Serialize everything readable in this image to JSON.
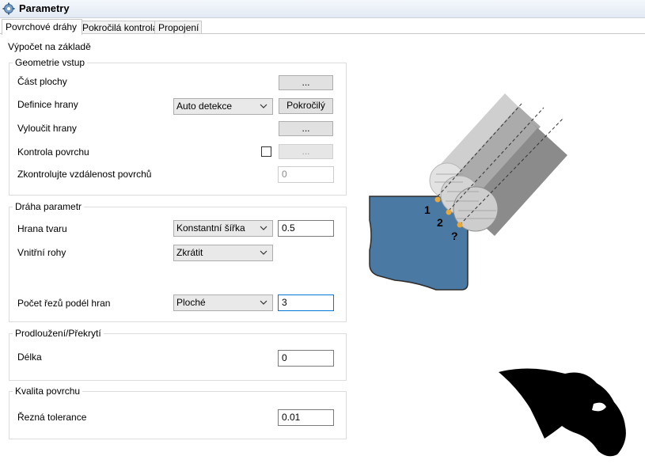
{
  "window": {
    "title": "Parametry"
  },
  "tabs": [
    {
      "label": "Povrchové dráhy",
      "active": true
    },
    {
      "label": "Pokročilá kontrola",
      "active": false
    },
    {
      "label": "Propojení",
      "active": false
    }
  ],
  "section_title": "Výpočet na základě",
  "geometry": {
    "legend": "Geometrie vstup",
    "surface_part": {
      "label": "Část plochy",
      "button": "..."
    },
    "edge_definition": {
      "label": "Definice hrany",
      "selected": "Auto detekce",
      "button": "Pokročilý"
    },
    "exclude_edges": {
      "label": "Vyloučit hrany",
      "button": "..."
    },
    "surface_check": {
      "label": "Kontrola povrchu",
      "checked": false,
      "button": "..."
    },
    "surface_distance": {
      "label": "Zkontrolujte vzdálenost povrchů",
      "value": "0"
    }
  },
  "path": {
    "legend": "Dráha parametr",
    "shape_edge": {
      "label": "Hrana tvaru",
      "selected": "Konstantní šířka",
      "value": "0.5"
    },
    "inner_corners": {
      "label": "Vnitřní rohy",
      "selected": "Zkrátit"
    },
    "cuts_along_edges": {
      "label": "Počet řezů podél hran",
      "selected": "Ploché",
      "value": "3"
    }
  },
  "extension": {
    "legend": "Prodloužení/Překrytí",
    "length": {
      "label": "Délka",
      "value": "0"
    }
  },
  "quality": {
    "legend": "Kvalita povrchu",
    "tolerance": {
      "label": "Řezná tolerance",
      "value": "0.01"
    }
  },
  "illustration": {
    "marker1": "1",
    "marker2": "2",
    "marker3": "?",
    "part_color": "#4a7aa3",
    "point_color": "#e8a83a"
  }
}
